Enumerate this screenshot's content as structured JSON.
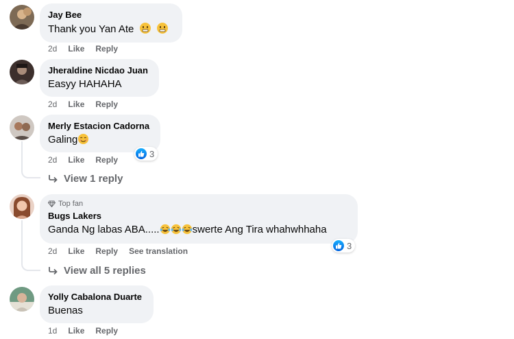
{
  "comments": [
    {
      "author": "Jay Bee",
      "text": "Thank you Yan Ate",
      "time": "2d",
      "like": "Like",
      "reply": "Reply"
    },
    {
      "author": "Jheraldine Nicdao Juan",
      "text": "Easyy HAHAHA",
      "time": "2d",
      "like": "Like",
      "reply": "Reply"
    },
    {
      "author": "Merly Estacion Cadorna",
      "text": "Galing",
      "time": "2d",
      "like": "Like",
      "reply": "Reply",
      "reactions": "3",
      "view_replies": "View 1 reply"
    },
    {
      "badge": "Top fan",
      "author": "Bugs Lakers",
      "text_before": "Ganda Ng labas ABA.....",
      "text_after": "swerte Ang Tira whahwhhaha",
      "time": "2d",
      "like": "Like",
      "reply": "Reply",
      "translate": "See translation",
      "reactions": "3",
      "view_replies": "View all 5 replies"
    },
    {
      "author": "Yolly Cabalona Duarte",
      "text": "Buenas",
      "time": "1d",
      "like": "Like",
      "reply": "Reply"
    }
  ],
  "icons": {
    "reaction": "like-reaction-icon",
    "reply_arrow": "reply-arrow-icon",
    "badge": "diamond-icon",
    "emoji_grin": "grinning-emoji-icon",
    "emoji_smile": "smile-emoji-icon",
    "emoji_laugh": "laughing-tears-emoji-icon"
  },
  "colors": {
    "bubble": "#f0f2f5",
    "meta": "#65676b",
    "like_blue": "#0866ff"
  }
}
